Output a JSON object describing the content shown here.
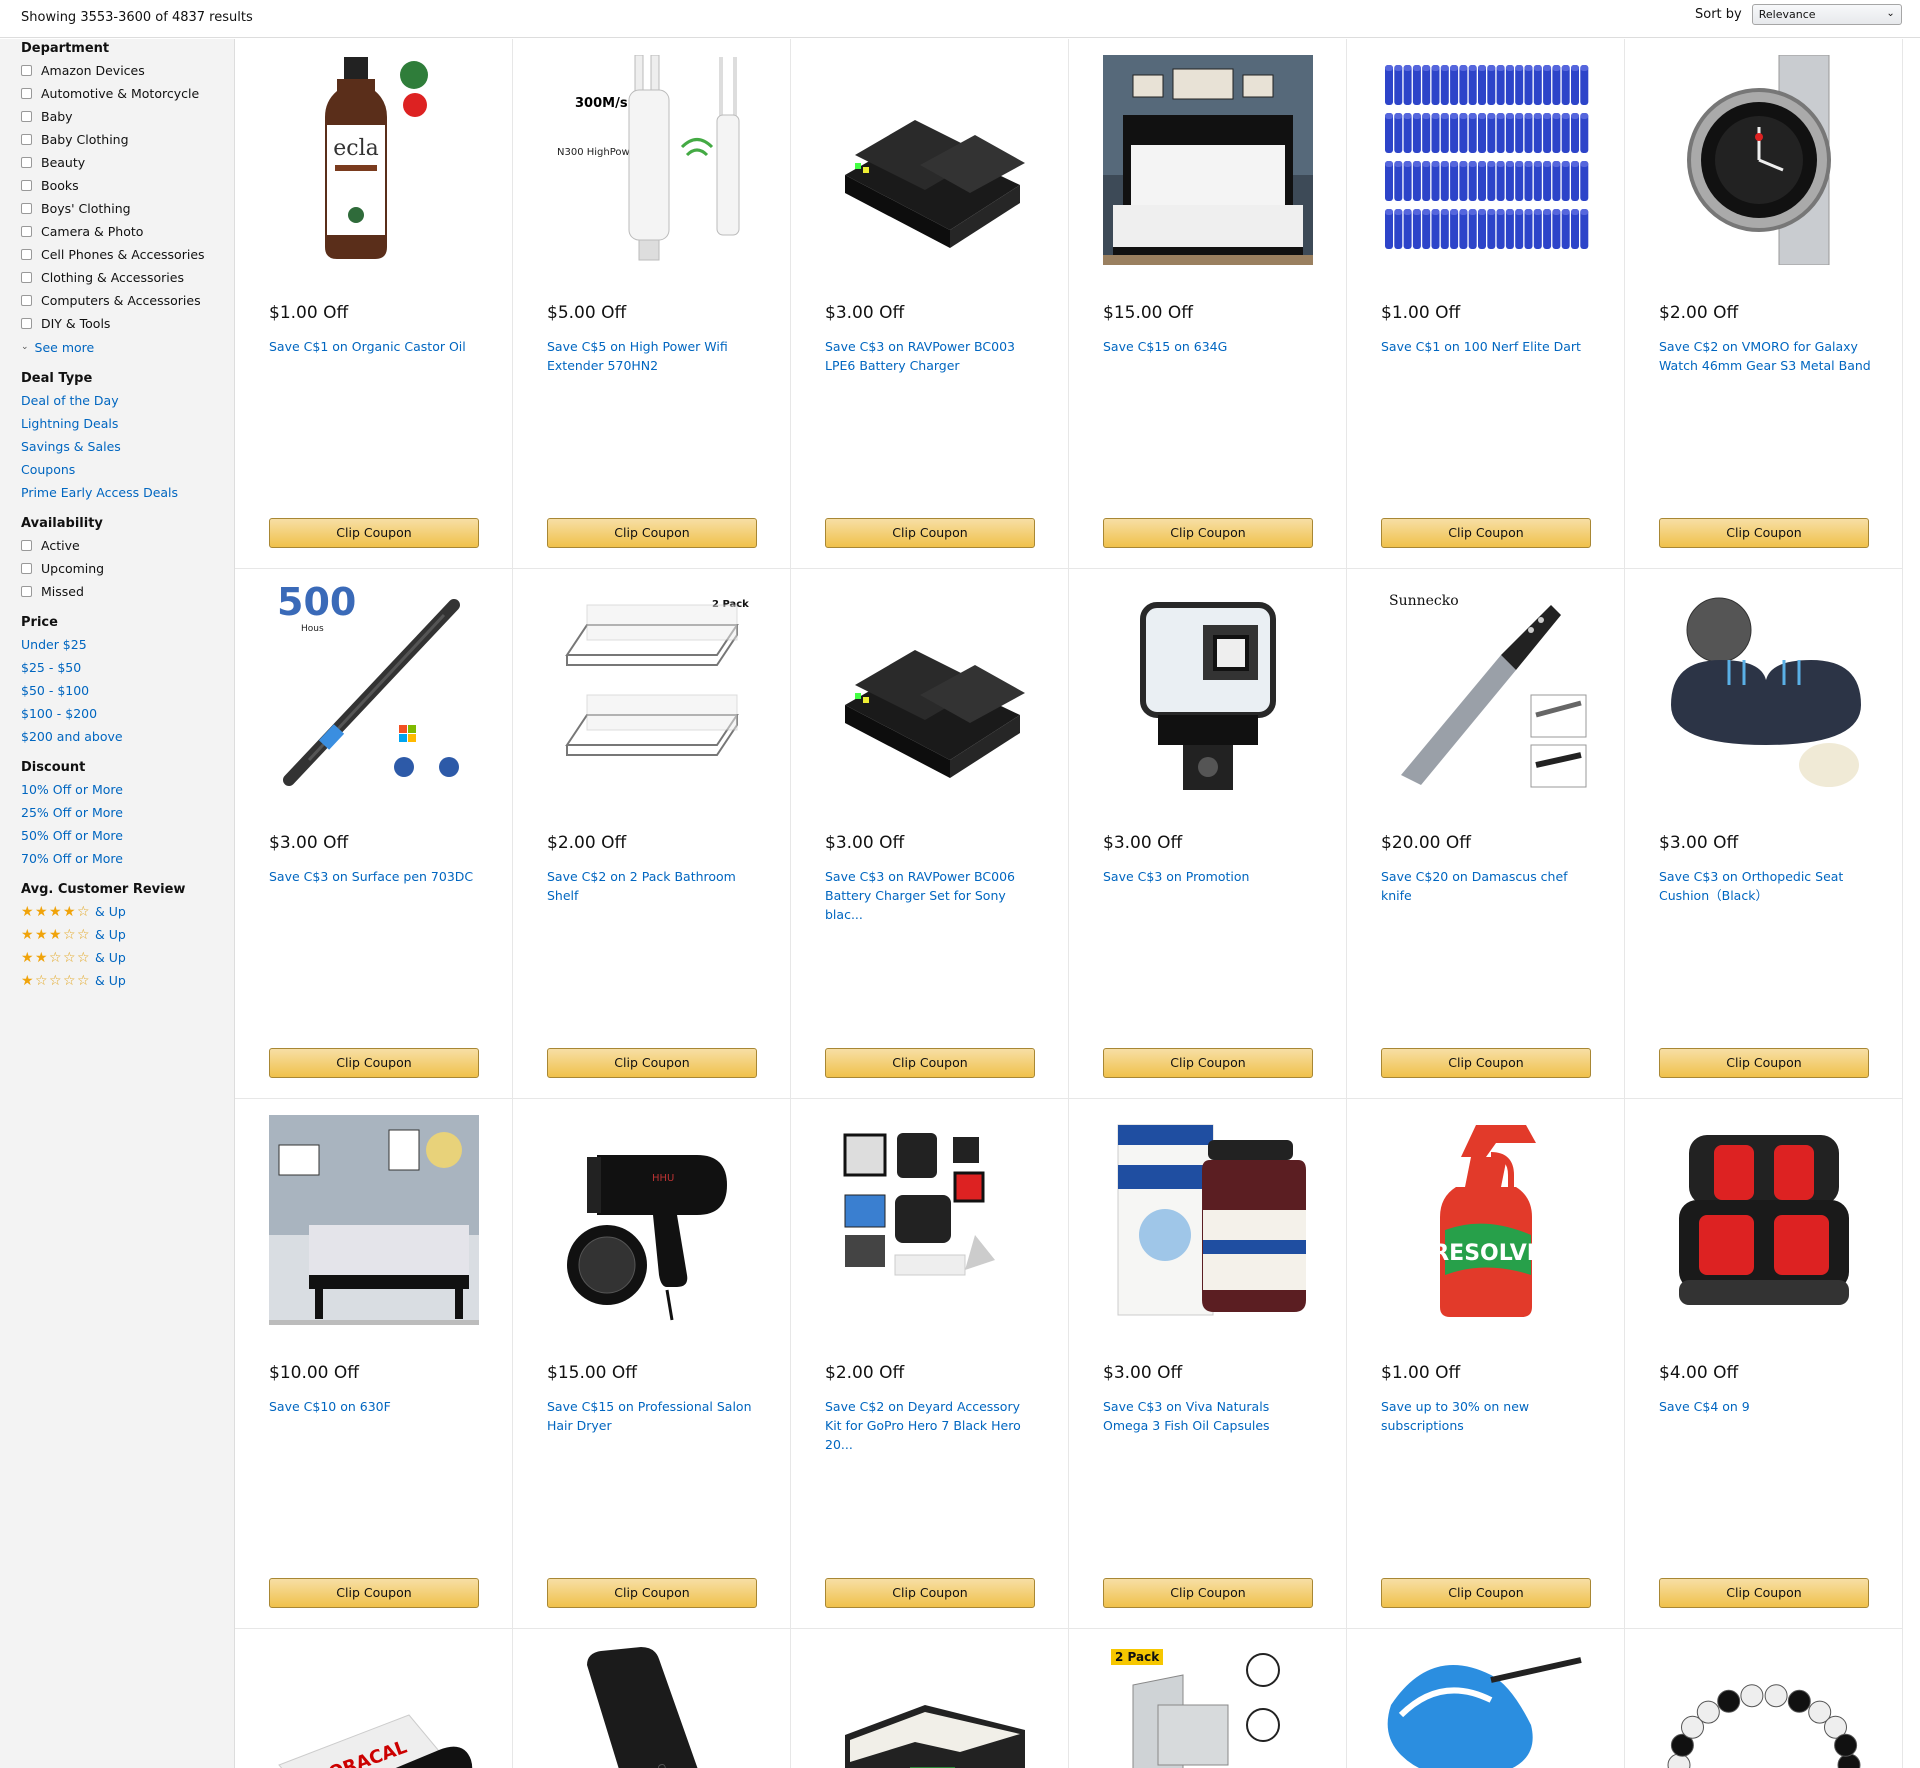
{
  "header": {
    "results_text": "Showing 3553-3600 of 4837 results",
    "sort_label": "Sort by",
    "sort_value": "Relevance"
  },
  "sidebar": {
    "department": {
      "heading": "Department",
      "items": [
        "Amazon Devices",
        "Automotive & Motorcycle",
        "Baby",
        "Baby Clothing",
        "Beauty",
        "Books",
        "Boys' Clothing",
        "Camera & Photo",
        "Cell Phones & Accessories",
        "Clothing & Accessories",
        "Computers & Accessories",
        "DIY & Tools"
      ],
      "see_more": "See more"
    },
    "deal_type": {
      "heading": "Deal Type",
      "items": [
        "Deal of the Day",
        "Lightning Deals",
        "Savings & Sales",
        "Coupons",
        "Prime Early Access Deals"
      ]
    },
    "availability": {
      "heading": "Availability",
      "items": [
        "Active",
        "Upcoming",
        "Missed"
      ]
    },
    "price": {
      "heading": "Price",
      "items": [
        "Under $25",
        "$25 - $50",
        "$50 - $100",
        "$100 - $200",
        "$200 and above"
      ]
    },
    "discount": {
      "heading": "Discount",
      "items": [
        "10% Off or More",
        "25% Off or More",
        "50% Off or More",
        "70% Off or More"
      ]
    },
    "review": {
      "heading": "Avg. Customer Review",
      "suffix": "& Up",
      "ratings": [
        4,
        3,
        2,
        1
      ]
    }
  },
  "button_label": "Clip Coupon",
  "products": [
    {
      "off": "$1.00 Off",
      "title": "Save C$1 on Organic Castor Oil",
      "icon": "castor-oil-bottle"
    },
    {
      "off": "$5.00 Off",
      "title": "Save C$5 on High Power Wifi Extender 570HN2",
      "icon": "wifi-extender"
    },
    {
      "off": "$3.00 Off",
      "title": "Save C$3 on RAVPower BC003 LPE6 Battery Charger",
      "icon": "battery-charger"
    },
    {
      "off": "$15.00 Off",
      "title": "Save C$15 on 634G",
      "icon": "metal-bed-frame"
    },
    {
      "off": "$1.00 Off",
      "title": "Save C$1 on 100 Nerf Elite Dart",
      "icon": "foam-darts"
    },
    {
      "off": "$2.00 Off",
      "title": "Save C$2 on VMORO for Galaxy Watch 46mm Gear S3 Metal Band",
      "icon": "smart-watch"
    },
    {
      "off": "$3.00 Off",
      "title": "Save C$3 on Surface pen 703DC",
      "icon": "stylus-pen"
    },
    {
      "off": "$2.00 Off",
      "title": "Save C$2 on 2 Pack Bathroom Shelf",
      "icon": "bathroom-shelf"
    },
    {
      "off": "$3.00 Off",
      "title": "Save C$3 on RAVPower BC006 Battery Charger Set for Sony blac...",
      "icon": "battery-charger"
    },
    {
      "off": "$3.00 Off",
      "title": "Save C$3 on Promotion",
      "icon": "camera-housing"
    },
    {
      "off": "$20.00 Off",
      "title": "Save C$20 on Damascus chef knife",
      "icon": "chef-knife"
    },
    {
      "off": "$3.00 Off",
      "title": "Save C$3 on Orthopedic Seat Cushion（Black）",
      "icon": "seat-cushion"
    },
    {
      "off": "$10.00 Off",
      "title": "Save C$10 on 630F",
      "icon": "platform-bed"
    },
    {
      "off": "$15.00 Off",
      "title": "Save C$15 on Professional Salon Hair Dryer",
      "icon": "hair-dryer"
    },
    {
      "off": "$2.00 Off",
      "title": "Save C$2 on Deyard Accessory Kit for GoPro Hero 7 Black Hero 20...",
      "icon": "accessory-kit"
    },
    {
      "off": "$3.00 Off",
      "title": "Save C$3 on Viva Naturals Omega 3 Fish Oil Capsules",
      "icon": "fish-oil"
    },
    {
      "off": "$1.00 Off",
      "title": "Save up to 30% on new subscriptions",
      "icon": "spray-bottle"
    },
    {
      "off": "$4.00 Off",
      "title": "Save C$4 on 9",
      "icon": "car-seat-covers"
    },
    {
      "off": "",
      "title": "",
      "icon": "vinyl-roll"
    },
    {
      "off": "",
      "title": "",
      "icon": "wireless-charger"
    },
    {
      "off": "",
      "title": "",
      "icon": "patio-furniture"
    },
    {
      "off": "",
      "title": "",
      "icon": "door-lock"
    },
    {
      "off": "",
      "title": "",
      "icon": "sunglasses"
    },
    {
      "off": "",
      "title": "",
      "icon": "bead-bracelet"
    }
  ]
}
